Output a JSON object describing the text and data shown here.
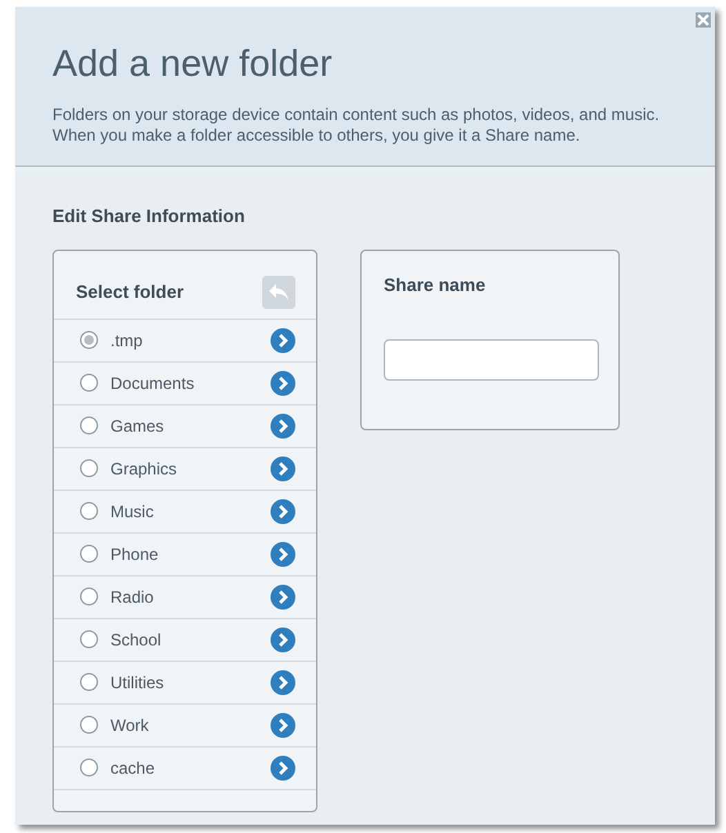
{
  "dialog": {
    "title": "Add a new folder",
    "description": [
      "Folders on your storage device contain content such as photos, videos, and music.",
      "When you make a folder accessible to others, you give it a Share name."
    ]
  },
  "section_title": "Edit Share Information",
  "folder_list": {
    "title": "Select folder",
    "back_disabled": true,
    "items": [
      {
        "label": ".tmp",
        "selected": true
      },
      {
        "label": "Documents",
        "selected": false
      },
      {
        "label": "Games",
        "selected": false
      },
      {
        "label": "Graphics",
        "selected": false
      },
      {
        "label": "Music",
        "selected": false
      },
      {
        "label": "Phone",
        "selected": false
      },
      {
        "label": "Radio",
        "selected": false
      },
      {
        "label": "School",
        "selected": false
      },
      {
        "label": "Utilities",
        "selected": false
      },
      {
        "label": "Work",
        "selected": false
      },
      {
        "label": "cache",
        "selected": false
      }
    ]
  },
  "share": {
    "label": "Share name"
  }
}
